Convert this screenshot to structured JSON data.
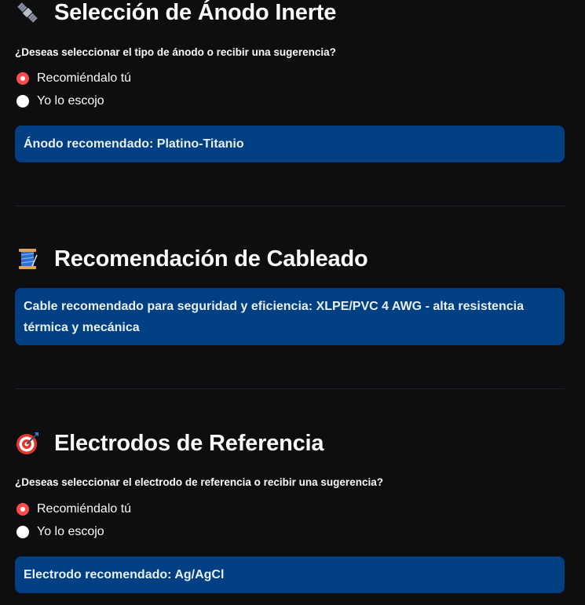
{
  "anode": {
    "icon": "satellite-icon",
    "title": "Selección de Ánodo Inerte",
    "question": "¿Deseas seleccionar el tipo de ánodo o recibir una sugerencia?",
    "options": [
      "Recomiéndalo tú",
      "Yo lo escojo"
    ],
    "selected": "Recomiéndalo tú",
    "recommendation": "Ánodo recomendado: Platino-Titanio"
  },
  "cabling": {
    "icon": "thread-spool-icon",
    "title": "Recomendación de Cableado",
    "recommendation": "Cable recomendado para seguridad y eficiencia: XLPE/PVC 4 AWG - alta resistencia térmica y mecánica"
  },
  "electrodes": {
    "icon": "target-dart-icon",
    "title": "Electrodos de Referencia",
    "question": "¿Deseas seleccionar el electrodo de referencia o recibir una sugerencia?",
    "options": [
      "Recomiéndalo tú",
      "Yo lo escojo"
    ],
    "selected": "Recomiéndalo tú",
    "recommendation": "Electrodo recomendado: Ag/AgCl"
  },
  "colors": {
    "background": "#0e0e10",
    "radio_selected": "#ff4b4b",
    "info_box": "#003f82"
  }
}
